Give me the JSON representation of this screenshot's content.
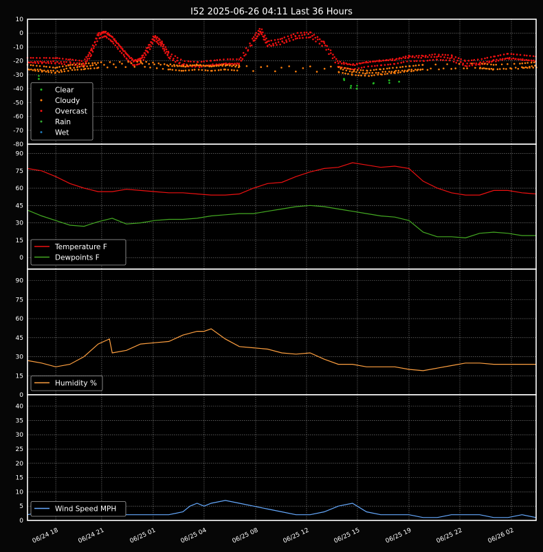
{
  "chart_data": {
    "title": "I52 2025-06-26 04:11 Last 36 Hours",
    "x_tick_labels": [
      "06/24 18",
      "06/24 21",
      "06/25 01",
      "06/25 04",
      "06/25 08",
      "06/25 12",
      "06/25 15",
      "06/25 19",
      "06/25 22",
      "06/26 02"
    ],
    "x_tick_positions_hours": [
      2.0,
      5.25,
      8.9,
      12.5,
      16.15,
      19.75,
      23.35,
      27.0,
      30.6,
      34.25
    ],
    "x_range_hours": [
      0,
      36
    ],
    "grid": true,
    "panels": [
      {
        "type": "scatter",
        "name": "sky",
        "ylim": [
          -80,
          10
        ],
        "yticks": [
          10,
          0,
          -10,
          -20,
          -30,
          -40,
          -50,
          -60,
          -70,
          -80
        ],
        "legend": [
          "Clear",
          "Cloudy",
          "Overcast",
          "Rain",
          "Wet"
        ],
        "legend_colors": [
          "#22bb22",
          "#ff7f0e",
          "#ee1111",
          "#33aa33",
          "#1f77b4"
        ],
        "legend_placement": "bottom-left",
        "series": [
          {
            "name": "Overcast",
            "color": "#ee1111",
            "x": [
              0.0,
              1.0,
              2.0,
              3.0,
              4.0,
              4.5,
              5.0,
              5.5,
              6.0,
              6.5,
              7.0,
              7.5,
              8.0,
              8.5,
              9.0,
              9.5,
              10.0,
              11.0,
              12.0,
              13.0,
              14.0,
              15.0,
              16.0,
              16.5,
              17.0,
              18.0,
              19.0,
              20.0,
              21.0,
              22.0,
              23.0,
              24.0,
              25.0,
              26.0,
              27.0,
              28.0,
              29.0,
              30.0,
              31.0,
              32.0,
              33.0,
              34.0,
              35.0,
              36.0
            ],
            "y": [
              -20,
              -20,
              -20,
              -21,
              -22,
              -14,
              -2,
              0,
              -4,
              -10,
              -16,
              -21,
              -20,
              -12,
              -3,
              -8,
              -16,
              -22,
              -23,
              -22,
              -21,
              -21,
              -5,
              2,
              -8,
              -6,
              -2,
              -1,
              -8,
              -22,
              -24,
              -22,
              -21,
              -20,
              -18,
              -18,
              -17,
              -18,
              -22,
              -21,
              -19,
              -17,
              -18,
              -19
            ]
          },
          {
            "name": "Cloudy",
            "color": "#ff7f0e",
            "x": [
              0.0,
              1.0,
              2.0,
              3.0,
              4.0,
              5.0,
              8.0,
              10.0,
              11.0,
              12.0,
              13.0,
              14.0,
              15.0,
              22.0,
              23.0,
              24.0,
              25.0,
              26.0,
              27.0,
              28.0,
              32.0,
              33.0,
              35.0,
              36.0
            ],
            "y": [
              -25,
              -26,
              -27,
              -25,
              -24,
              -23,
              -22,
              -24,
              -25,
              -24,
              -25,
              -24,
              -25,
              -26,
              -28,
              -29,
              -28,
              -27,
              -26,
              -25,
              -24,
              -25,
              -24,
              -23
            ]
          },
          {
            "name": "Clear",
            "color": "#22bb22",
            "x": [
              0.8,
              22.4,
              22.9,
              23.3,
              24.5,
              25.6,
              26.3
            ],
            "y": [
              -33,
              -33,
              -38,
              -40,
              -36,
              -34,
              -35
            ]
          }
        ]
      },
      {
        "type": "line",
        "name": "temperature",
        "ylim": [
          -10,
          98
        ],
        "yticks": [
          90,
          75,
          60,
          45,
          30,
          15,
          0
        ],
        "legend": [
          "Temperature F",
          "Dewpoints F"
        ],
        "legend_placement": "bottom-left",
        "series": [
          {
            "name": "Temperature F",
            "color": "#ee1111",
            "x": [
              0,
              1,
              2,
              3,
              4,
              5,
              6,
              7,
              8,
              9,
              10,
              11,
              12,
              13,
              14,
              15,
              16,
              17,
              18,
              19,
              20,
              21,
              22,
              23,
              24,
              25,
              26,
              27,
              28,
              29,
              30,
              31,
              32,
              33,
              34,
              35,
              36
            ],
            "y": [
              77,
              75,
              70,
              64,
              60,
              57,
              57,
              59,
              58,
              57,
              56,
              56,
              55,
              54,
              54,
              55,
              60,
              64,
              65,
              70,
              74,
              77,
              78,
              82,
              80,
              78,
              79,
              77,
              66,
              60,
              56,
              54,
              54,
              58,
              58,
              56,
              55
            ]
          },
          {
            "name": "Dewpoints F",
            "color": "#44aa22",
            "x": [
              0,
              1,
              2,
              3,
              4,
              5,
              6,
              7,
              8,
              9,
              10,
              11,
              12,
              13,
              14,
              15,
              16,
              17,
              18,
              19,
              20,
              21,
              22,
              23,
              24,
              25,
              26,
              27,
              28,
              29,
              30,
              31,
              32,
              33,
              34,
              35,
              36
            ],
            "y": [
              41,
              36,
              32,
              28,
              27,
              31,
              34,
              29,
              30,
              32,
              33,
              33,
              34,
              36,
              37,
              38,
              38,
              40,
              42,
              44,
              45,
              44,
              42,
              40,
              38,
              36,
              35,
              32,
              22,
              18,
              18,
              17,
              21,
              22,
              21,
              19,
              19
            ]
          }
        ]
      },
      {
        "type": "line",
        "name": "humidity",
        "ylim": [
          0,
          99
        ],
        "yticks": [
          90,
          75,
          60,
          45,
          30,
          15,
          0
        ],
        "legend": [
          "Humidity %"
        ],
        "legend_placement": "bottom-left",
        "series": [
          {
            "name": "Humidity %",
            "color": "#ffa040",
            "x": [
              0,
              1,
              2,
              3,
              4,
              5,
              5.8,
              6,
              7,
              8,
              9,
              10,
              11,
              12,
              12.5,
              13,
              14,
              15,
              16,
              17,
              18,
              19,
              20,
              21,
              22,
              23,
              24,
              25,
              26,
              27,
              28,
              29,
              30,
              31,
              32,
              33,
              34,
              35,
              36
            ],
            "y": [
              27,
              25,
              22,
              24,
              30,
              40,
              44,
              33,
              35,
              40,
              41,
              42,
              47,
              50,
              50,
              52,
              44,
              38,
              37,
              36,
              33,
              32,
              33,
              28,
              24,
              24,
              22,
              22,
              22,
              20,
              19,
              21,
              23,
              25,
              25,
              24,
              24,
              24,
              24
            ]
          }
        ]
      },
      {
        "type": "line",
        "name": "wind",
        "ylim": [
          0,
          44
        ],
        "yticks": [
          40,
          35,
          30,
          25,
          20,
          15,
          10,
          5,
          0
        ],
        "legend": [
          "Wind Speed MPH"
        ],
        "legend_placement": "bottom-left",
        "series": [
          {
            "name": "Wind Speed MPH",
            "color": "#66aaff",
            "x": [
              0,
              1,
              2,
              3,
              4,
              5,
              6,
              7,
              8,
              9,
              10,
              11,
              11.5,
              12,
              12.5,
              13,
              14,
              15,
              16,
              17,
              18,
              19,
              20,
              21,
              22,
              23,
              24,
              25,
              26,
              27,
              28,
              29,
              30,
              31,
              32,
              33,
              34,
              35,
              36
            ],
            "y": [
              2,
              3,
              2,
              2,
              3,
              2,
              2,
              2,
              2,
              2,
              2,
              3,
              5,
              6,
              5,
              6,
              7,
              6,
              5,
              4,
              3,
              2,
              2,
              3,
              5,
              6,
              3,
              2,
              2,
              2,
              1,
              1,
              2,
              2,
              2,
              1,
              1,
              2,
              1
            ]
          }
        ]
      }
    ]
  }
}
